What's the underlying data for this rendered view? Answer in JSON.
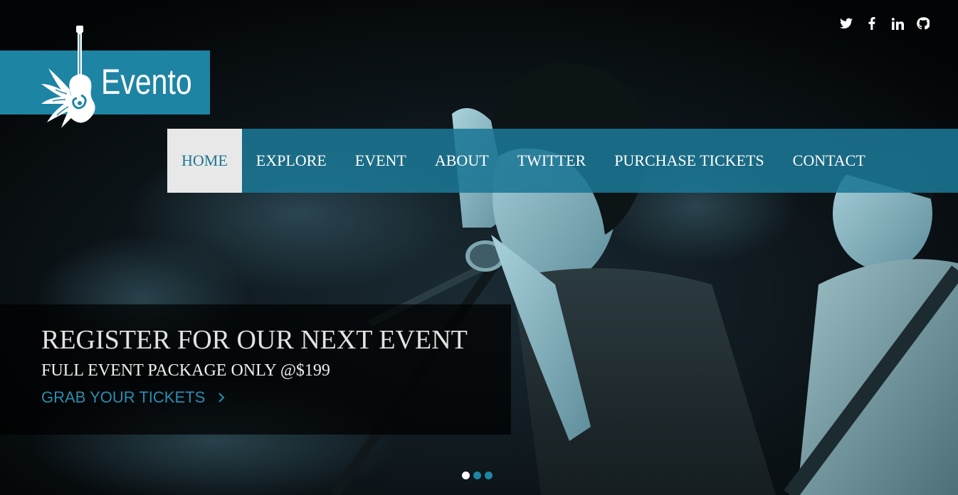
{
  "brand": {
    "name": "Evento"
  },
  "social": [
    {
      "name": "twitter-icon"
    },
    {
      "name": "facebook-icon"
    },
    {
      "name": "linkedin-icon"
    },
    {
      "name": "github-icon"
    }
  ],
  "nav": {
    "items": [
      {
        "label": "HOME",
        "active": true
      },
      {
        "label": "EXPLORE"
      },
      {
        "label": "EVENT"
      },
      {
        "label": "ABOUT"
      },
      {
        "label": "TWITTER"
      },
      {
        "label": "PURCHASE TICKETS"
      },
      {
        "label": "CONTACT"
      }
    ]
  },
  "hero": {
    "title": "REGISTER FOR OUR NEXT EVENT",
    "subtitle": "FULL EVENT PACKAGE ONLY @$199",
    "cta_label": "GRAB YOUR TICKETS",
    "cta_icon": "chevron-right-icon"
  },
  "slider": {
    "count": 3,
    "active": 1
  },
  "colors": {
    "accent": "#1e84a3",
    "nav_bg": "#1b7694",
    "active_nav_bg": "#e8e8e8",
    "active_nav_text": "#1e7593",
    "cta_text": "#2a8db0"
  }
}
